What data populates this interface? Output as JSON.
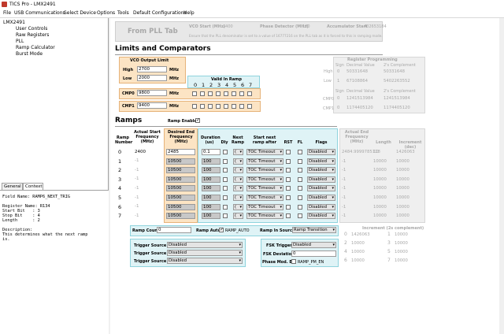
{
  "window_title": "TICS Pro - LMX2491",
  "menu": [
    "File",
    "USB Communications",
    "Select Device",
    "Options",
    "Tools",
    "Default Configurations",
    "Help"
  ],
  "tree": {
    "root": "LMX2491",
    "items": [
      "User Controls",
      "Raw Registers",
      "PLL",
      "Ramp Calculator",
      "Burst Mode"
    ]
  },
  "tabs": [
    "General",
    "Context"
  ],
  "context_text": "Field Name: RAMP6_NEXT_TRIG\n\nRegister Name: R134\nStart Bit   : 3\nStop Bit    : 4\nLength      : 2\n\nDescription:\nThis determines what the next ramp\nis.",
  "from_pll": {
    "title": "From PLL Tab",
    "vco_start_label": "VCO Start (MHz)",
    "vco_start": "2400",
    "phase_det_label": "Phase Detector (MHz)",
    "phase_det": "100",
    "acc_start_label": "Accumulator Start",
    "acc_start": "402653184",
    "note": "Ensure that the PLL denominator is set to a value of 16777216 on the PLL tab as it is forced to this in ramping mode."
  },
  "limits": {
    "heading": "Limits and Comparators",
    "vco_output_limit": "VCO Output Limit",
    "high_label": "High",
    "high": "2700",
    "low_label": "Low",
    "low": "2000",
    "mhz": "MHz",
    "valid_in_ramp": "Valid In Ramp",
    "ramp_digits": [
      "0",
      "1",
      "2",
      "3",
      "4",
      "5",
      "6",
      "7"
    ],
    "cmp0_label": "CMP0",
    "cmp0": "9800",
    "cmp1_label": "CMP1",
    "cmp1": "9400",
    "reg_prog": "Register Programming",
    "sign": "Sign",
    "decimal_value": "Decimal Value",
    "twos_complement": "2's Complement",
    "high_sign": "0",
    "high_dec": "50331648",
    "high_twos": "50331648",
    "low_sign": "1",
    "low_dec": "67108864",
    "low_twos": "5402263552",
    "cmp0_sign": "0",
    "cmp0_dec": "1241513984",
    "cmp0_twos": "1241513984",
    "cmp1_sign": "0",
    "cmp1_dec": "1174405120",
    "cmp1_twos": "1174405120"
  },
  "ramps": {
    "heading": "Ramps",
    "ramp_enable": "Ramp Enable",
    "headers": {
      "ramp_number": "Ramp Number",
      "actual_start": "Actual Start Frequency (MHz)",
      "desired_end": "Desired End Frequency (MHz)",
      "duration": "Duration (us)",
      "dly": "Dly",
      "next_ramp": "Next Ramp",
      "start_next": "Start next ramp after",
      "rst": "RST",
      "fl": "FL",
      "flags": "Flags",
      "actual_end": "Actual End Frequency (MHz)",
      "length": "Length",
      "increment": "Increment (dec)"
    },
    "rows": [
      {
        "n": "0",
        "start": "2400",
        "end": "2485",
        "dur": "0.1",
        "next": "(",
        "after": "TOC Timeout",
        "flags": "Disabled",
        "aend": "2484.9999785118",
        "len": "10",
        "inc": "1426063"
      },
      {
        "n": "1",
        "start": "-1",
        "end": "10500",
        "dur": "100",
        "next": "(",
        "after": "TOC Timeout",
        "flags": "Disabled",
        "aend": "-1",
        "len": "10000",
        "inc": "10000"
      },
      {
        "n": "2",
        "start": "-1",
        "end": "10500",
        "dur": "100",
        "next": "(",
        "after": "TOC Timeout",
        "flags": "Disabled",
        "aend": "-1",
        "len": "10000",
        "inc": "10000"
      },
      {
        "n": "3",
        "start": "-1",
        "end": "10500",
        "dur": "100",
        "next": "(",
        "after": "TOC Timeout",
        "flags": "Disabled",
        "aend": "-1",
        "len": "10000",
        "inc": "10000"
      },
      {
        "n": "4",
        "start": "-1",
        "end": "10500",
        "dur": "100",
        "next": "(",
        "after": "TOC Timeout",
        "flags": "Disabled",
        "aend": "-1",
        "len": "10000",
        "inc": "10000"
      },
      {
        "n": "5",
        "start": "-1",
        "end": "10500",
        "dur": "100",
        "next": "(",
        "after": "TOC Timeout",
        "flags": "Disabled",
        "aend": "-1",
        "len": "10000",
        "inc": "10000"
      },
      {
        "n": "6",
        "start": "-1",
        "end": "10500",
        "dur": "100",
        "next": "(",
        "after": "TOC Timeout",
        "flags": "Disabled",
        "aend": "-1",
        "len": "10000",
        "inc": "10000"
      },
      {
        "n": "7",
        "start": "-1",
        "end": "10500",
        "dur": "100",
        "next": "(",
        "after": "TOC Timeout",
        "flags": "Disabled",
        "aend": "-1",
        "len": "10000",
        "inc": "10000"
      }
    ],
    "ramp_count_label": "Ramp Count",
    "ramp_count": "0",
    "ramp_auto_label": "Ramp Auto",
    "ramp_auto_name": "RAMP_AUTO",
    "ramp_in_source_label": "Ramp In Source",
    "ramp_in_source": "Ramp Transition",
    "inc2_title": "Increment (2s complement)",
    "inc2": [
      [
        "0",
        "1426063"
      ],
      [
        "1",
        "10000"
      ],
      [
        "2",
        "10000"
      ],
      [
        "3",
        "10000"
      ],
      [
        "4",
        "10000"
      ],
      [
        "5",
        "10000"
      ],
      [
        "6",
        "10000"
      ],
      [
        "7",
        "10000"
      ]
    ],
    "trig_a_label": "Trigger Source A",
    "trig_a": "Disabled",
    "trig_b_label": "Trigger Source B",
    "trig_b": "Disabled",
    "trig_c_label": "Trigger Source C",
    "trig_c": "Disabled",
    "fsk_trigger_label": "FSK Trigger",
    "fsk_trigger": "Disabled",
    "fsk_dev_label": "FSK Deviation",
    "fsk_dev": "0",
    "phase_mod_label": "Phase Mod. En",
    "phase_mod_name": "RAMP_PM_EN"
  }
}
